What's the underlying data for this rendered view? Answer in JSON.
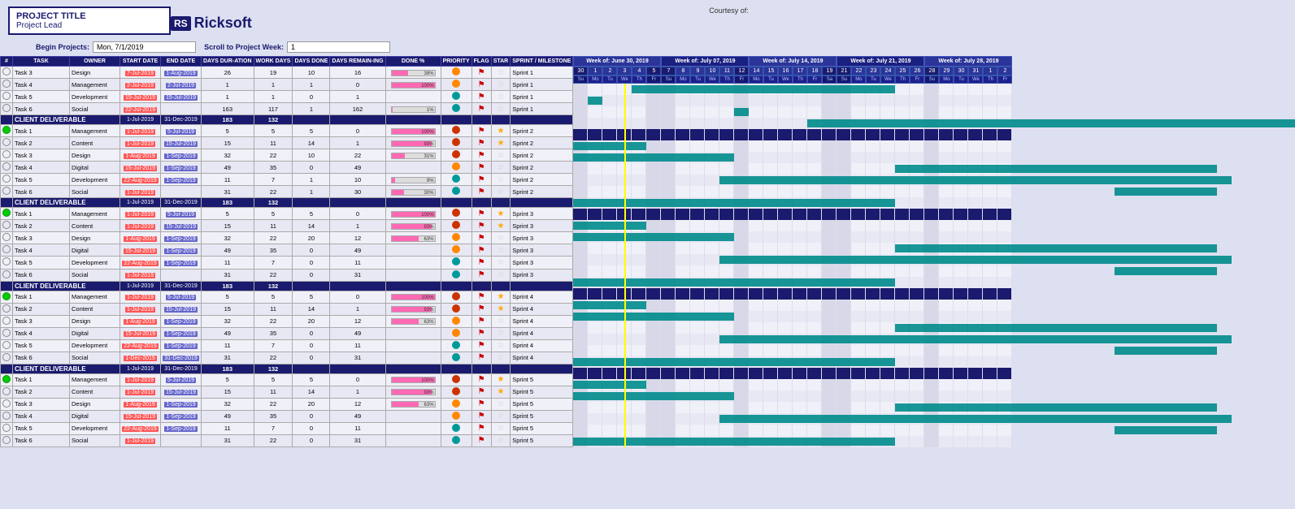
{
  "header": {
    "project_title": "PROJECT TITLE",
    "project_lead": "Project Lead",
    "courtesy": "Courtesy of:",
    "logo_rs": "RS",
    "logo_name": "Ricksoft",
    "begin_projects_label": "Begin Projects:",
    "begin_projects_value": "Mon, 7/1/2019",
    "scroll_label": "Scroll to Project Week:",
    "scroll_value": "1"
  },
  "columns": {
    "num": "#",
    "task": "TASK",
    "owner": "OWNER",
    "start_date": "START DATE",
    "end_date": "END DATE",
    "days_duration": "DAYS DURATION",
    "work_days": "WORK DAYS",
    "days_done": "DAYS DONE",
    "days_remaining": "DAYS REMAINING",
    "done_pct": "DONE %",
    "priority": "PRIORITY",
    "flag": "FLAG",
    "star": "STAR",
    "sprint_milestone": "SPRINT / MILESTONE"
  },
  "weeks": [
    "Week of: June 30, 2019",
    "Week of: July 07, 2019",
    "Week of: July 14, 2019",
    "Week of: July 21, 2019",
    "Week of: July 28, 2019"
  ],
  "sprints": [
    {
      "section_label": "CLIENT DELIVERABLE",
      "section_start": "1-Jul-2019",
      "section_end": "31-Dec-2019",
      "section_days": "183",
      "section_workdays": "132",
      "sprint_name": "Sprint 1",
      "tasks": [
        {
          "num": "",
          "name": "Task 3",
          "owner": "Design",
          "start": "7-Jul-2019",
          "end": "1-Aug-2019",
          "days": "26",
          "work": "19",
          "done": "10",
          "remain": "16",
          "pct": 38,
          "priority": "orange",
          "flag": true,
          "star": false,
          "sprint": "Sprint 1",
          "status": "empty",
          "gantt_start": 5,
          "gantt_len": 18
        },
        {
          "num": "",
          "name": "Task 4",
          "owner": "Management",
          "start": "2-Jul-2019",
          "end": "2-Jul-2019",
          "days": "1",
          "work": "1",
          "done": "1",
          "remain": "0",
          "pct": 100,
          "priority": "orange",
          "flag": true,
          "star": false,
          "sprint": "Sprint 1",
          "status": "empty",
          "gantt_start": 2,
          "gantt_len": 1
        },
        {
          "num": "",
          "name": "Task 5",
          "owner": "Development",
          "start": "15-Jul-2019",
          "end": "15-Jul-2019",
          "days": "1",
          "work": "1",
          "done": "0",
          "remain": "1",
          "pct": 0,
          "priority": "teal",
          "flag": true,
          "star": false,
          "sprint": "Sprint 1",
          "status": "empty",
          "gantt_start": 12,
          "gantt_len": 1
        },
        {
          "num": "",
          "name": "Task 6",
          "owner": "Social",
          "start": "22-Jul-2019",
          "end": "",
          "days": "163",
          "work": "117",
          "done": "1",
          "remain": "162",
          "pct": 1,
          "priority": "teal",
          "flag": true,
          "star": false,
          "sprint": "Sprint 1",
          "status": "empty",
          "gantt_start": 17,
          "gantt_len": 50
        }
      ]
    },
    {
      "section_label": "CLIENT DELIVERABLE",
      "section_start": "1-Jul-2019",
      "section_end": "31-Dec-2019",
      "section_days": "183",
      "section_workdays": "132",
      "sprint_name": "Sprint 2",
      "tasks": [
        {
          "num": "",
          "name": "Task 1",
          "owner": "Management",
          "start": "1-Jul-2019",
          "end": "5-Jul-2019",
          "days": "5",
          "work": "5",
          "done": "5",
          "remain": "0",
          "pct": 100,
          "priority": "red",
          "flag": true,
          "star": true,
          "sprint": "Sprint 2",
          "status": "green",
          "gantt_start": 1,
          "gantt_len": 5
        },
        {
          "num": "",
          "name": "Task 2",
          "owner": "Content",
          "start": "1-Jul-2019",
          "end": "15-Jul-2019",
          "days": "15",
          "work": "11",
          "done": "14",
          "remain": "1",
          "pct": 93,
          "priority": "red",
          "flag": true,
          "star": true,
          "sprint": "Sprint 2",
          "status": "empty",
          "gantt_start": 1,
          "gantt_len": 11
        },
        {
          "num": "",
          "name": "Task 3",
          "owner": "Design",
          "start": "1-Aug-2019",
          "end": "1-Sep-2019",
          "days": "32",
          "work": "22",
          "done": "10",
          "remain": "22",
          "pct": 31,
          "priority": "red",
          "flag": true,
          "star": false,
          "sprint": "Sprint 2",
          "status": "empty",
          "gantt_start": 23,
          "gantt_len": 22
        },
        {
          "num": "",
          "name": "Task 4",
          "owner": "Digital",
          "start": "15-Jul-2019",
          "end": "1-Sep-2019",
          "days": "49",
          "work": "35",
          "done": "0",
          "remain": "49",
          "pct": 0,
          "priority": "orange",
          "flag": true,
          "star": false,
          "sprint": "Sprint 2",
          "status": "empty",
          "gantt_start": 11,
          "gantt_len": 35
        },
        {
          "num": "",
          "name": "Task 5",
          "owner": "Development",
          "start": "22-Aug-2019",
          "end": "1-Sep-2019",
          "days": "11",
          "work": "7",
          "done": "1",
          "remain": "10",
          "pct": 9,
          "priority": "teal",
          "flag": true,
          "star": false,
          "sprint": "Sprint 2",
          "status": "empty",
          "gantt_start": 38,
          "gantt_len": 7
        },
        {
          "num": "",
          "name": "Task 6",
          "owner": "Social",
          "start": "1-Jul-2019",
          "end": "",
          "days": "31",
          "work": "22",
          "done": "1",
          "remain": "30",
          "pct": 30,
          "priority": "teal",
          "flag": true,
          "star": false,
          "sprint": "Sprint 2",
          "status": "empty",
          "gantt_start": 1,
          "gantt_len": 22
        }
      ]
    },
    {
      "section_label": "CLIENT DELIVERABLE",
      "section_start": "1-Jul-2019",
      "section_end": "31-Dec-2019",
      "section_days": "183",
      "section_workdays": "132",
      "sprint_name": "Sprint 3",
      "tasks": [
        {
          "num": "",
          "name": "Task 1",
          "owner": "Management",
          "start": "1-Jul-2019",
          "end": "5-Jul-2019",
          "days": "5",
          "work": "5",
          "done": "5",
          "remain": "0",
          "pct": 100,
          "priority": "red",
          "flag": true,
          "star": true,
          "sprint": "Sprint 3",
          "status": "green",
          "gantt_start": 1,
          "gantt_len": 5
        },
        {
          "num": "",
          "name": "Task 2",
          "owner": "Content",
          "start": "1-Jul-2019",
          "end": "15-Jul-2019",
          "days": "15",
          "work": "11",
          "done": "14",
          "remain": "1",
          "pct": 93,
          "priority": "red",
          "flag": true,
          "star": true,
          "sprint": "Sprint 3",
          "status": "empty",
          "gantt_start": 1,
          "gantt_len": 11
        },
        {
          "num": "",
          "name": "Task 3",
          "owner": "Design",
          "start": "1-Aug-2019",
          "end": "1-Sep-2019",
          "days": "32",
          "work": "22",
          "done": "20",
          "remain": "12",
          "pct": 63,
          "priority": "orange",
          "flag": true,
          "star": false,
          "sprint": "Sprint 3",
          "status": "empty",
          "gantt_start": 23,
          "gantt_len": 22
        },
        {
          "num": "",
          "name": "Task 4",
          "owner": "Digital",
          "start": "15-Jul-2019",
          "end": "1-Sep-2019",
          "days": "49",
          "work": "35",
          "done": "0",
          "remain": "49",
          "pct": 0,
          "priority": "orange",
          "flag": true,
          "star": false,
          "sprint": "Sprint 3",
          "status": "empty",
          "gantt_start": 11,
          "gantt_len": 35
        },
        {
          "num": "",
          "name": "Task 5",
          "owner": "Development",
          "start": "22-Aug-2019",
          "end": "1-Sep-2019",
          "days": "11",
          "work": "7",
          "done": "0",
          "remain": "11",
          "pct": 0,
          "priority": "teal",
          "flag": true,
          "star": false,
          "sprint": "Sprint 3",
          "status": "empty",
          "gantt_start": 38,
          "gantt_len": 7
        },
        {
          "num": "",
          "name": "Task 6",
          "owner": "Social",
          "start": "1-Jul-2019",
          "end": "",
          "days": "31",
          "work": "22",
          "done": "0",
          "remain": "31",
          "pct": 0,
          "priority": "teal",
          "flag": true,
          "star": false,
          "sprint": "Sprint 3",
          "status": "empty",
          "gantt_start": 1,
          "gantt_len": 22
        }
      ]
    },
    {
      "section_label": "CLIENT DELIVERABLE",
      "section_start": "1-Jul-2019",
      "section_end": "31-Dec-2019",
      "section_days": "183",
      "section_workdays": "132",
      "sprint_name": "Sprint 4",
      "tasks": [
        {
          "num": "",
          "name": "Task 1",
          "owner": "Management",
          "start": "1-Jul-2019",
          "end": "5-Jul-2019",
          "days": "5",
          "work": "5",
          "done": "5",
          "remain": "0",
          "pct": 100,
          "priority": "red",
          "flag": true,
          "star": true,
          "sprint": "Sprint 4",
          "status": "green",
          "gantt_start": 1,
          "gantt_len": 5
        },
        {
          "num": "",
          "name": "Task 2",
          "owner": "Content",
          "start": "1-Jul-2019",
          "end": "15-Jul-2019",
          "days": "15",
          "work": "11",
          "done": "14",
          "remain": "1",
          "pct": 93,
          "priority": "red",
          "flag": true,
          "star": true,
          "sprint": "Sprint 4",
          "status": "empty",
          "gantt_start": 1,
          "gantt_len": 11
        },
        {
          "num": "",
          "name": "Task 3",
          "owner": "Design",
          "start": "1-Aug-2019",
          "end": "1-Sep-2019",
          "days": "32",
          "work": "22",
          "done": "20",
          "remain": "12",
          "pct": 63,
          "priority": "orange",
          "flag": true,
          "star": false,
          "sprint": "Sprint 4",
          "status": "empty",
          "gantt_start": 23,
          "gantt_len": 22
        },
        {
          "num": "",
          "name": "Task 4",
          "owner": "Digital",
          "start": "15-Jul-2019",
          "end": "1-Sep-2019",
          "days": "49",
          "work": "35",
          "done": "0",
          "remain": "49",
          "pct": 0,
          "priority": "orange",
          "flag": true,
          "star": false,
          "sprint": "Sprint 4",
          "status": "empty",
          "gantt_start": 11,
          "gantt_len": 35
        },
        {
          "num": "",
          "name": "Task 5",
          "owner": "Development",
          "start": "22-Aug-2019",
          "end": "1-Sep-2019",
          "days": "11",
          "work": "7",
          "done": "0",
          "remain": "11",
          "pct": 0,
          "priority": "teal",
          "flag": true,
          "star": false,
          "sprint": "Sprint 4",
          "status": "empty",
          "gantt_start": 38,
          "gantt_len": 7
        },
        {
          "num": "",
          "name": "Task 6",
          "owner": "Social",
          "start": "1-Dec-2019",
          "end": "31-Dec-2019",
          "days": "31",
          "work": "22",
          "done": "0",
          "remain": "31",
          "pct": 0,
          "priority": "teal",
          "flag": true,
          "star": false,
          "sprint": "Sprint 4",
          "status": "empty",
          "gantt_start": 1,
          "gantt_len": 22
        }
      ]
    },
    {
      "section_label": "CLIENT DELIVERABLE",
      "section_start": "1-Jul-2019",
      "section_end": "31-Dec-2019",
      "section_days": "183",
      "section_workdays": "132",
      "sprint_name": "Sprint 5",
      "tasks": [
        {
          "num": "",
          "name": "Task 1",
          "owner": "Management",
          "start": "1-Jul-2019",
          "end": "5-Jul-2019",
          "days": "5",
          "work": "5",
          "done": "5",
          "remain": "0",
          "pct": 100,
          "priority": "red",
          "flag": true,
          "star": true,
          "sprint": "Sprint 5",
          "status": "green",
          "gantt_start": 1,
          "gantt_len": 5
        },
        {
          "num": "",
          "name": "Task 2",
          "owner": "Content",
          "start": "1-Jul-2019",
          "end": "15-Jul-2019",
          "days": "15",
          "work": "11",
          "done": "14",
          "remain": "1",
          "pct": 93,
          "priority": "red",
          "flag": true,
          "star": true,
          "sprint": "Sprint 5",
          "status": "empty",
          "gantt_start": 1,
          "gantt_len": 11
        },
        {
          "num": "",
          "name": "Task 3",
          "owner": "Design",
          "start": "1-Aug-2019",
          "end": "1-Sep-2019",
          "days": "32",
          "work": "22",
          "done": "20",
          "remain": "12",
          "pct": 63,
          "priority": "orange",
          "flag": true,
          "star": false,
          "sprint": "Sprint 5",
          "status": "empty",
          "gantt_start": 23,
          "gantt_len": 22
        },
        {
          "num": "",
          "name": "Task 4",
          "owner": "Digital",
          "start": "15-Jul-2019",
          "end": "1-Sep-2019",
          "days": "49",
          "work": "35",
          "done": "0",
          "remain": "49",
          "pct": 0,
          "priority": "orange",
          "flag": true,
          "star": false,
          "sprint": "Sprint 5",
          "status": "empty",
          "gantt_start": 11,
          "gantt_len": 35
        },
        {
          "num": "",
          "name": "Task 5",
          "owner": "Development",
          "start": "22-Aug-2019",
          "end": "1-Sep-2019",
          "days": "11",
          "work": "7",
          "done": "0",
          "remain": "11",
          "pct": 0,
          "priority": "teal",
          "flag": true,
          "star": false,
          "sprint": "Sprint 5",
          "status": "empty",
          "gantt_start": 38,
          "gantt_len": 7
        },
        {
          "num": "",
          "name": "Task 6",
          "owner": "Social",
          "start": "1-Jul-2019",
          "end": "",
          "days": "31",
          "work": "22",
          "done": "0",
          "remain": "31",
          "pct": 0,
          "priority": "teal",
          "flag": true,
          "star": false,
          "sprint": "Sprint 5",
          "status": "empty",
          "gantt_start": 1,
          "gantt_len": 22
        }
      ]
    }
  ],
  "gantt": {
    "week_days": [
      {
        "week": 0,
        "days": [
          30,
          1,
          2,
          3,
          4,
          5
        ],
        "names": [
          "Su",
          "Mo",
          "Tu",
          "We",
          "Th",
          "Fr"
        ]
      },
      {
        "week": 1,
        "days": [
          7,
          8,
          9,
          10,
          11,
          12
        ],
        "names": [
          "Su",
          "Mo",
          "Tu",
          "We",
          "Th",
          "Fr"
        ]
      },
      {
        "week": 2,
        "days": [
          14,
          15,
          16,
          17,
          18,
          19
        ],
        "names": [
          "Mo",
          "Tu",
          "We",
          "Th",
          "Fr",
          "Sa"
        ]
      },
      {
        "week": 3,
        "days": [
          21,
          22,
          23,
          24,
          25,
          26
        ],
        "names": [
          "Su",
          "Mo",
          "Tu",
          "We",
          "Th",
          "Fr"
        ]
      },
      {
        "week": 4,
        "days": [
          28,
          29,
          30,
          31,
          1,
          2
        ],
        "names": [
          "Su",
          "Mo",
          "Tu",
          "We",
          "Th",
          "Fr"
        ]
      }
    ]
  },
  "colors": {
    "header_bg": "#1a1a6e",
    "section_bg": "#1a1a6e",
    "accent_blue": "#2233aa",
    "gantt_teal": "#008b8b",
    "today_line": "#ffff00",
    "row_light": "#f0f0f8",
    "row_alt": "#e0e0f0"
  }
}
